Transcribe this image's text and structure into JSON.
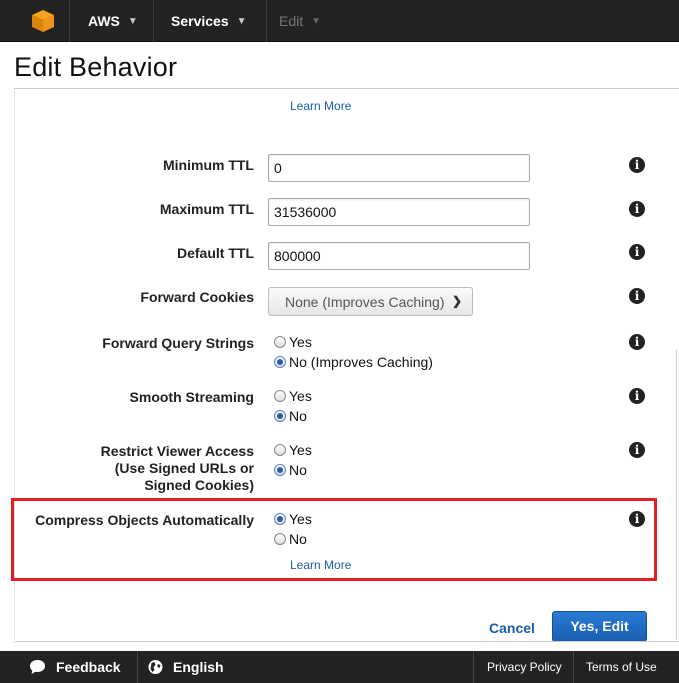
{
  "nav": {
    "aws_label": "AWS",
    "services_label": "Services",
    "edit_label": "Edit",
    "chevron": "⌄"
  },
  "page": {
    "title": "Edit Behavior",
    "learn_more": "Learn More"
  },
  "form": {
    "min_ttl": {
      "label": "Minimum TTL",
      "value": "0"
    },
    "max_ttl": {
      "label": "Maximum TTL",
      "value": "31536000"
    },
    "default_ttl": {
      "label": "Default TTL",
      "value": "800000"
    },
    "forward_cookies": {
      "label": "Forward Cookies",
      "selected": "None (Improves Caching)"
    },
    "forward_query_strings": {
      "label": "Forward Query Strings",
      "options": [
        "Yes",
        "No (Improves Caching)"
      ],
      "selected_index": 1
    },
    "smooth_streaming": {
      "label": "Smooth Streaming",
      "options": [
        "Yes",
        "No"
      ],
      "selected_index": 1
    },
    "restrict_viewer_access": {
      "label_line1": "Restrict Viewer Access",
      "label_line2": "(Use Signed URLs or",
      "label_line3": "Signed Cookies)",
      "options": [
        "Yes",
        "No"
      ],
      "selected_index": 1
    },
    "compress_objects": {
      "label": "Compress Objects Automatically",
      "options": [
        "Yes",
        "No"
      ],
      "selected_index": 0
    }
  },
  "actions": {
    "cancel": "Cancel",
    "confirm": "Yes, Edit"
  },
  "footer": {
    "feedback": "Feedback",
    "language": "English",
    "privacy": "Privacy Policy",
    "terms": "Terms of Use"
  },
  "colors": {
    "highlight": "#e21f26",
    "link": "#1a5ea8",
    "primary": "#1f6fc5",
    "navbar": "#232323"
  },
  "icons": {
    "info": "info-icon",
    "logo": "aws-cube-icon",
    "feedback": "speech-bubble-icon",
    "language": "globe-icon"
  }
}
